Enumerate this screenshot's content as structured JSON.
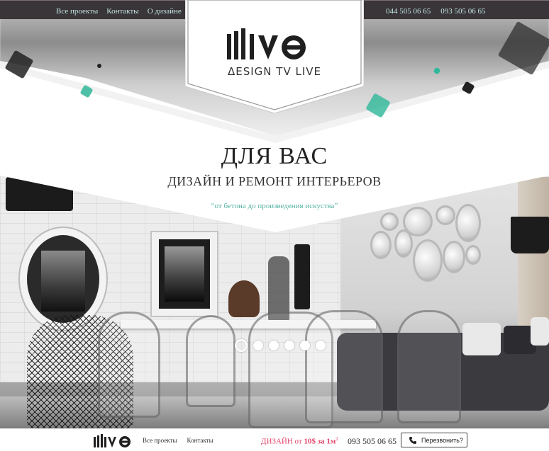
{
  "topbar": {
    "nav": [
      "Все проекты",
      "Контакты",
      "О дизайне"
    ],
    "phones": [
      "044 505 06 65",
      "093 505 06 65"
    ]
  },
  "logo": {
    "wordmark": "lllivo",
    "tagline": "ΔESIGN TV LIVE"
  },
  "hero": {
    "title": "ДЛЯ ВАС",
    "subtitle": "ДИЗАЙН И РЕМОНТ ИНТЕРЬЕРОВ",
    "slogan": "“от бетона до произведения искуства”",
    "slides": 6,
    "active_slide": 1
  },
  "footer": {
    "logo": "lllivo",
    "nav": [
      "Все проекты",
      "Контакты"
    ],
    "promo_prefix": "ДИЗАЙН от ",
    "promo_price": "10$ за 1м",
    "promo_sup": "2",
    "phone": "093 505 06 65",
    "callback_label": "Перезвонить?"
  },
  "colors": {
    "topbar_bg": "#3a3539",
    "topbar_text": "#bfe4dd",
    "accent_teal": "#56b2a3",
    "promo_pink": "#e2456a"
  },
  "icons": [
    "phone-icon"
  ]
}
